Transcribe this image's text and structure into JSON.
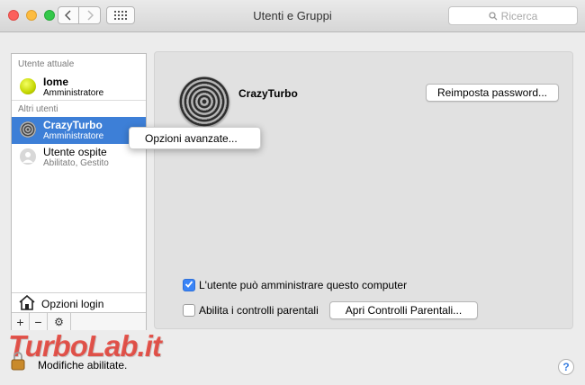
{
  "window": {
    "title": "Utenti e Gruppi"
  },
  "search": {
    "placeholder": "Ricerca"
  },
  "sidebar": {
    "current_header": "Utente attuale",
    "current_user": {
      "name": "Iome",
      "role": "Amministratore"
    },
    "other_header": "Altri utenti",
    "other_users": [
      {
        "name": "CrazyTurbo",
        "role": "Amministratore",
        "selected": true
      },
      {
        "name": "Utente ospite",
        "role": "Abilitato, Gestito",
        "selected": false
      }
    ],
    "login_options": "Opzioni login",
    "toolbar": {
      "add": "+",
      "remove": "−",
      "settings": "⚙"
    }
  },
  "context_menu": {
    "item": "Opzioni avanzate..."
  },
  "detail": {
    "user_name": "CrazyTurbo",
    "reset_password_button": "Reimposta password...",
    "admin_checkbox": {
      "label": "L'utente può amministrare questo computer",
      "checked": true
    },
    "parental_checkbox": {
      "label": "Abilita i controlli parentali",
      "checked": false
    },
    "parental_button": "Apri Controlli Parentali..."
  },
  "footer": {
    "status": "Modifiche abilitate.",
    "help": "?"
  },
  "watermark": "TurboLab.it",
  "colors": {
    "selection": "#3d7fd7",
    "checkbox": "#3a84f7",
    "watermark": "#e6281e"
  }
}
